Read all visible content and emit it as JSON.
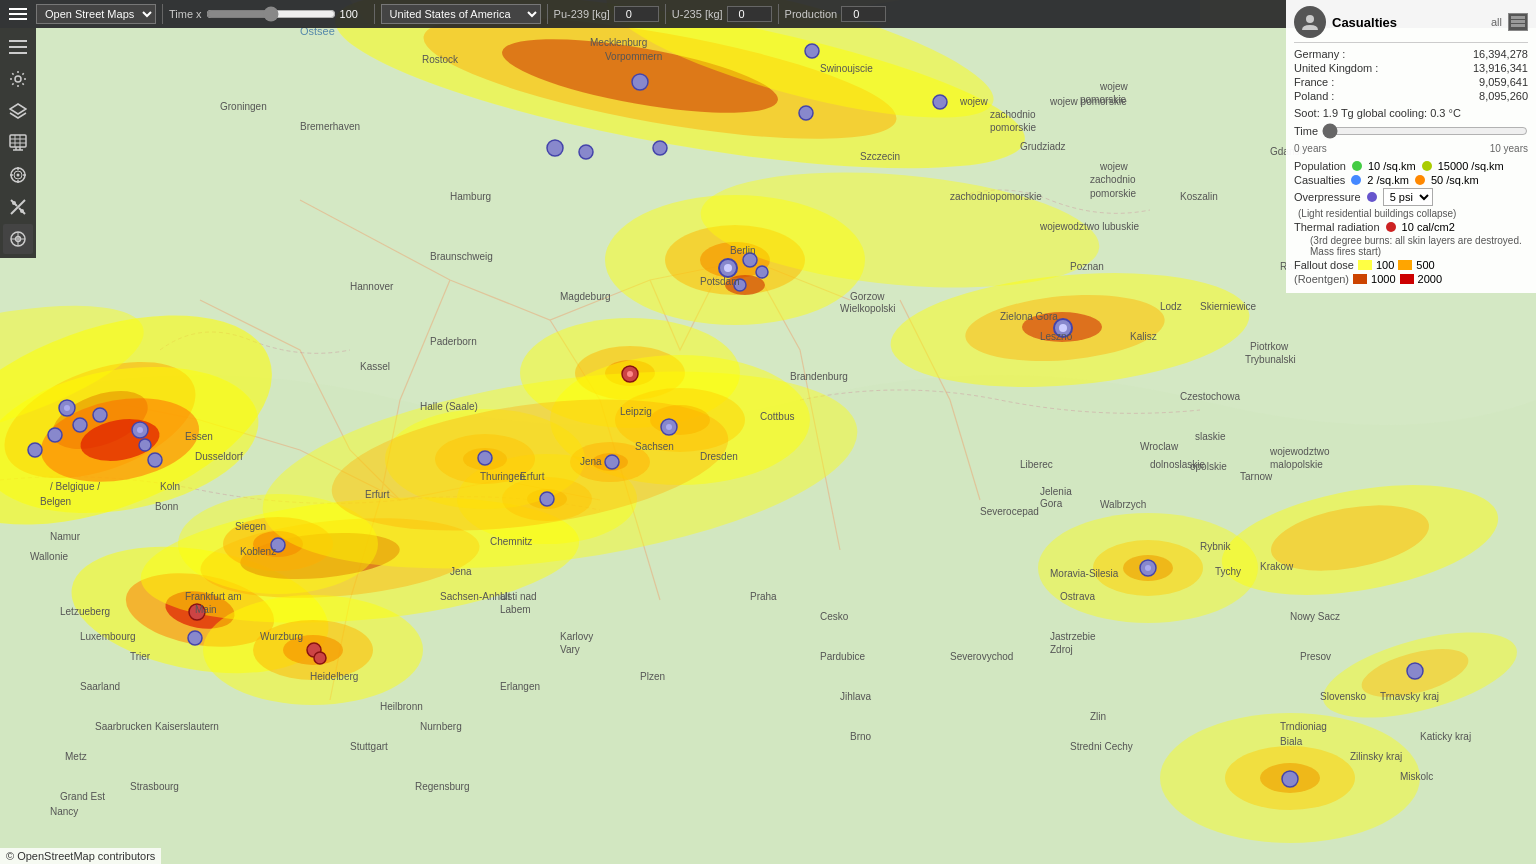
{
  "toolbar": {
    "map_type": "Open Street Maps",
    "time_label": "Time x",
    "time_value": 100,
    "country": "United States of America",
    "pu239_label": "Pu-239 [kg]",
    "pu239_value": 0,
    "u235_label": "U-235 [kg]",
    "u235_value": 0,
    "production_label": "Production",
    "production_value": 0
  },
  "sidebar": {
    "icons": [
      {
        "name": "menu-icon",
        "glyph": "≡"
      },
      {
        "name": "settings-icon",
        "glyph": "⚙"
      },
      {
        "name": "layers-icon",
        "glyph": "☰"
      },
      {
        "name": "data-icon",
        "glyph": "📊"
      },
      {
        "name": "target-icon",
        "glyph": "◎"
      },
      {
        "name": "tools-icon",
        "glyph": "✂"
      },
      {
        "name": "location-icon",
        "glyph": "⊕"
      }
    ]
  },
  "right_panel": {
    "title": "Casualties",
    "all_label": "all",
    "countries": [
      {
        "name": "Germany :",
        "value": "16,394,278"
      },
      {
        "name": "United Kingdom :",
        "value": "13,916,341"
      },
      {
        "name": "France :",
        "value": "9,059,641"
      },
      {
        "name": "Poland :",
        "value": "8,095,260"
      }
    ],
    "soot": "Soot: 1.9 Tg    global cooling: 0.3 °C",
    "time_label": "Time",
    "time_start": "0 years",
    "time_end": "10 years",
    "legend": {
      "population_label": "Population",
      "pop_green_val": "10 /sq.km",
      "pop_yellow_val": "15000 /sq.km",
      "casualties_label": "Casualties",
      "cas_blue_val": "2 /sq.km",
      "cas_orange_val": "50 /sq.km",
      "overpressure_label": "Overpressure",
      "overpressure_value": "5 psi",
      "overpressure_note": "(Light residential buildings collapse)",
      "thermal_label": "Thermal radiation",
      "thermal_value": "10 cal/cm2",
      "thermal_note": "(3rd degree burns: all skin layers are destroyed. Mass fires start)",
      "fallout_label": "Fallout dose",
      "fallout_items": [
        {
          "color": "#ffff00",
          "label": "100"
        },
        {
          "color": "#ffa500",
          "label": "500"
        },
        {
          "color": "#cc4400",
          "label": "1000"
        },
        {
          "color": "#cc0000",
          "label": "2000"
        }
      ],
      "fallout_unit": "(Roentgen)"
    }
  },
  "attribution": {
    "text": "© OpenStreetMap contributors"
  }
}
